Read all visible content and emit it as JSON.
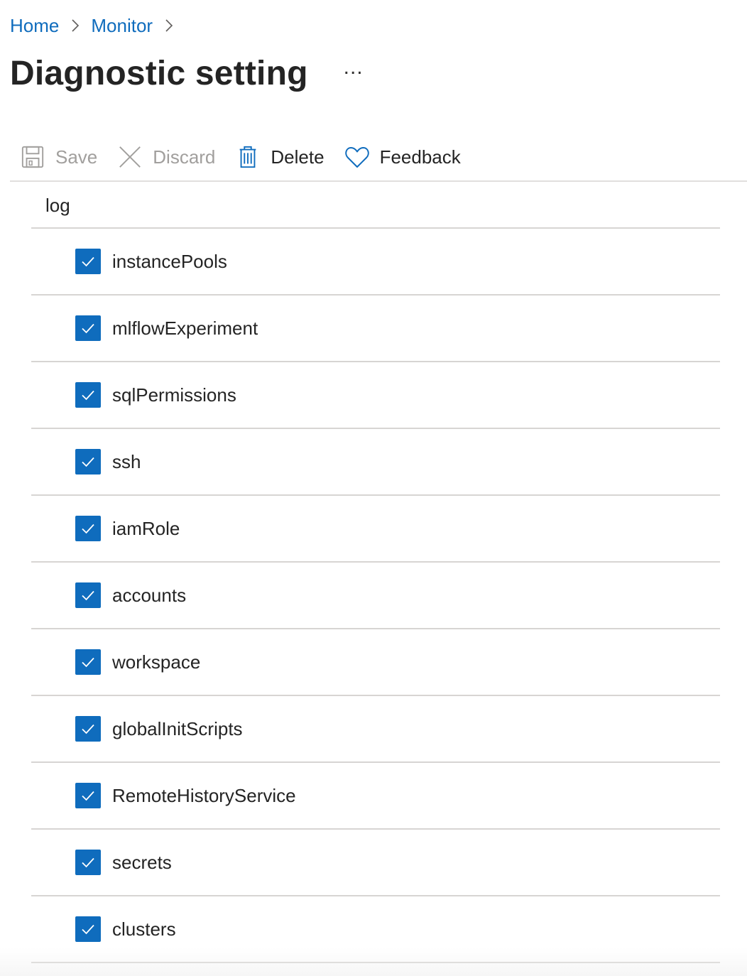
{
  "breadcrumb": {
    "items": [
      "Home",
      "Monitor"
    ]
  },
  "header": {
    "title": "Diagnostic setting",
    "more_label": "..."
  },
  "toolbar": {
    "save_label": "Save",
    "discard_label": "Discard",
    "delete_label": "Delete",
    "feedback_label": "Feedback",
    "save_enabled": false,
    "discard_enabled": false
  },
  "colors": {
    "link": "#0f6cbd",
    "checkbox": "#0f6cbd",
    "disabled_text": "#a19f9d"
  },
  "table": {
    "column_header": "log",
    "rows": [
      {
        "label": "instancePools",
        "checked": true
      },
      {
        "label": "mlflowExperiment",
        "checked": true
      },
      {
        "label": "sqlPermissions",
        "checked": true
      },
      {
        "label": "ssh",
        "checked": true
      },
      {
        "label": "iamRole",
        "checked": true
      },
      {
        "label": "accounts",
        "checked": true
      },
      {
        "label": "workspace",
        "checked": true
      },
      {
        "label": "globalInitScripts",
        "checked": true
      },
      {
        "label": "RemoteHistoryService",
        "checked": true
      },
      {
        "label": "secrets",
        "checked": true
      },
      {
        "label": "clusters",
        "checked": true
      }
    ]
  }
}
